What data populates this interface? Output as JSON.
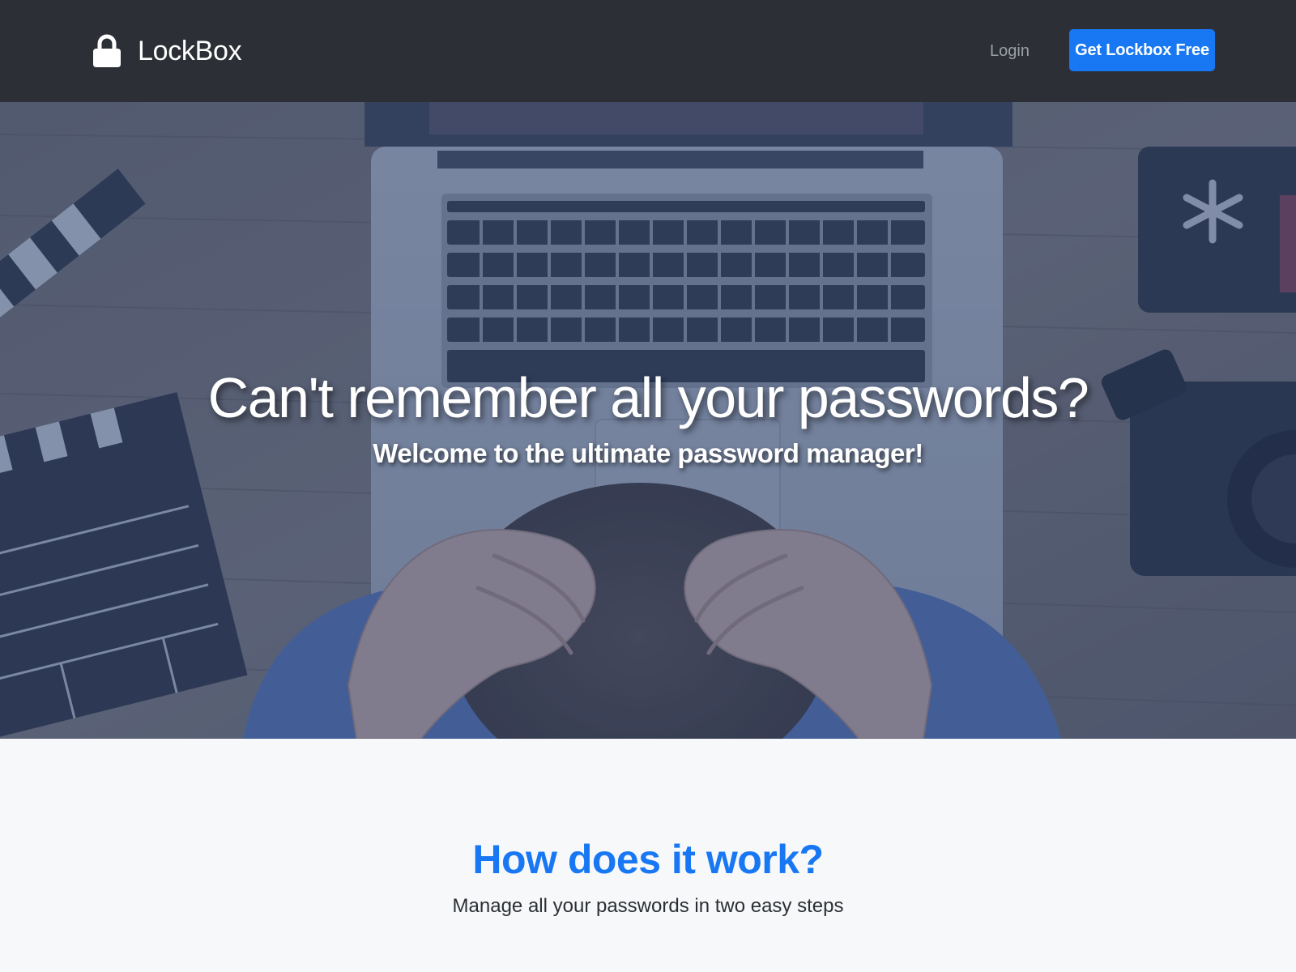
{
  "navbar": {
    "brand_name": "LockBox",
    "brand_icon": "lock-icon",
    "login_label": "Login",
    "cta_label": "Get Lockbox Free",
    "background_color": "#2c2f35",
    "cta_color": "#1877f2"
  },
  "hero": {
    "title": "Can't remember all your passwords?",
    "subtitle": "Welcome to the ultimate password manager!",
    "background_image": "frustrated person holding head at desk with laptop, clapperboard and camera",
    "overlay_color": "#3a5a9a"
  },
  "how_it_works": {
    "title": "How does it work?",
    "subtitle": "Manage all your passwords in two easy steps",
    "title_color": "#1877f2"
  }
}
